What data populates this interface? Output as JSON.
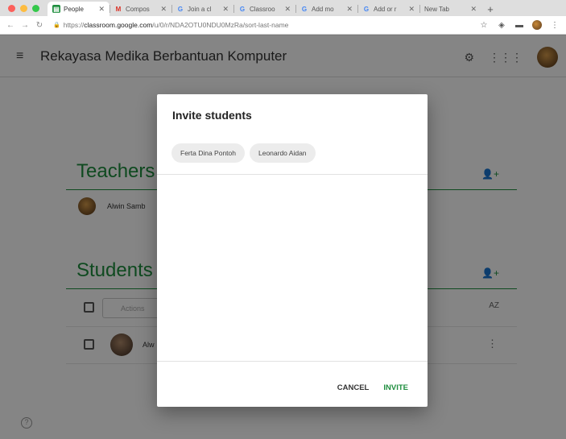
{
  "browser": {
    "tabs": [
      {
        "label": "People",
        "favicon": "classroom-icon",
        "favicon_color": "#1e8e3e",
        "active": true
      },
      {
        "label": "Compos",
        "favicon": "gmail-icon",
        "favicon_color": "#d93025",
        "active": false
      },
      {
        "label": "Join a cl",
        "favicon": "google-icon",
        "favicon_color": "#4285f4",
        "active": false
      },
      {
        "label": "Classroo",
        "favicon": "google-icon",
        "favicon_color": "#4285f4",
        "active": false
      },
      {
        "label": "Add mo",
        "favicon": "google-icon",
        "favicon_color": "#4285f4",
        "active": false
      },
      {
        "label": "Add or r",
        "favicon": "google-icon",
        "favicon_color": "#4285f4",
        "active": false
      },
      {
        "label": "New Tab",
        "favicon": "",
        "favicon_color": "#888888",
        "active": false
      }
    ],
    "url_scheme": "https://",
    "url_host": "classroom.google.com",
    "url_path": "/u/0/r/NDA2OTU0NDU0MzRa/sort-last-name"
  },
  "app": {
    "course_title": "Rekayasa Medika Berbantuan Komputer",
    "accent_color": "#1e8e3e"
  },
  "teachers": {
    "heading": "Teachers",
    "items": [
      {
        "name": "Alwin Samb"
      }
    ]
  },
  "students": {
    "heading": "Students",
    "actions_label": "Actions",
    "sort_label": "AZ",
    "items": [
      {
        "name": "Alw"
      }
    ]
  },
  "dialog": {
    "title": "Invite students",
    "chips": [
      "Ferta Dina Pontoh",
      "Leonardo Aidan"
    ],
    "cancel_label": "CANCEL",
    "invite_label": "INVITE"
  }
}
